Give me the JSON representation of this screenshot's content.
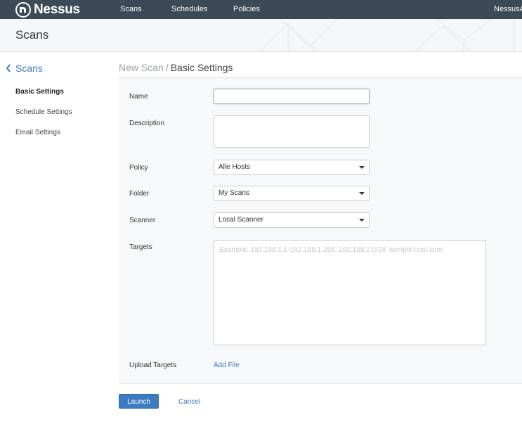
{
  "topbar": {
    "brand": "Nessus",
    "nav": [
      "Scans",
      "Schedules",
      "Policies"
    ],
    "user": "NessusAdmin"
  },
  "header": {
    "title": "Scans"
  },
  "sidebar": {
    "back_label": "Scans",
    "items": [
      {
        "label": "Basic Settings",
        "active": true
      },
      {
        "label": "Schedule Settings",
        "active": false
      },
      {
        "label": "Email Settings",
        "active": false
      }
    ]
  },
  "breadcrumb": {
    "parent": "New Scan",
    "separator": "/",
    "current": "Basic Settings"
  },
  "form": {
    "name": {
      "label": "Name",
      "value": ""
    },
    "description": {
      "label": "Description",
      "value": ""
    },
    "policy": {
      "label": "Policy",
      "value": "Alle Hosts"
    },
    "folder": {
      "label": "Folder",
      "value": "My Scans"
    },
    "scanner": {
      "label": "Scanner",
      "value": "Local Scanner"
    },
    "targets": {
      "label": "Targets",
      "value": "",
      "placeholder": "Example: 192.168.1.1-192.168.1.255, 192.168.2.0/24, sample.host.com"
    },
    "upload_targets": {
      "label": "Upload Targets",
      "link": "Add File"
    }
  },
  "actions": {
    "launch": "Launch",
    "cancel": "Cancel"
  },
  "colors": {
    "topbar": "#3c4a57",
    "accent": "#3b7bbf",
    "panel": "#f7f8f9"
  }
}
